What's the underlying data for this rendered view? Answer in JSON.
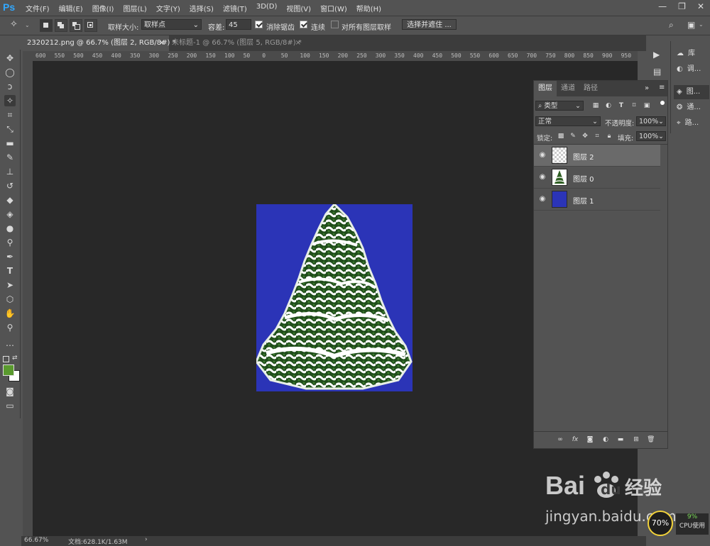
{
  "app": {
    "logo": "Ps"
  },
  "menu": [
    "文件(F)",
    "编辑(E)",
    "图像(I)",
    "图层(L)",
    "文字(Y)",
    "选择(S)",
    "滤镜(T)",
    "3D(D)",
    "视图(V)",
    "窗口(W)",
    "帮助(H)"
  ],
  "window_controls": {
    "minimize": "—",
    "restore": "❐",
    "close": "✕"
  },
  "options": {
    "sample_size_label": "取样大小:",
    "sample_size_value": "取样点",
    "tolerance_label": "容差:",
    "tolerance_value": "45",
    "antialias_label": "消除锯齿",
    "contiguous_label": "连续",
    "all_layers_label": "对所有图层取样",
    "select_mask_button": "选择并遮住 ..."
  },
  "tabs": [
    {
      "label": "2320212.png @ 66.7% (图层 2, RGB/8#) *",
      "close": "×"
    },
    {
      "label": "未标题-1 @ 66.7% (图层 5, RGB/8#) *",
      "close": "×"
    }
  ],
  "ruler_ticks": [
    "600",
    "550",
    "500",
    "450",
    "400",
    "350",
    "300",
    "250",
    "200",
    "150",
    "100",
    "50",
    "0",
    "50",
    "100",
    "150",
    "200",
    "250",
    "300",
    "350",
    "400",
    "450",
    "500",
    "550",
    "600",
    "650",
    "700",
    "750",
    "800",
    "850",
    "900",
    "950"
  ],
  "status": {
    "zoom": "66.67%",
    "doc": "文档:628.1K/1.63M",
    "arrow": "›"
  },
  "dock": [
    {
      "icon": "cc-libraries-icon",
      "label": "库"
    },
    {
      "icon": "adjustments-icon",
      "label": "调..."
    },
    {
      "icon": "layers-icon",
      "label": "图..."
    },
    {
      "icon": "channels-icon",
      "label": "通..."
    },
    {
      "icon": "paths-icon",
      "label": "路..."
    }
  ],
  "layers_panel": {
    "tabs": [
      "图层",
      "通道",
      "路径"
    ],
    "filter_kind": "类型",
    "blend_mode": "正常",
    "opacity_label": "不透明度:",
    "opacity_value": "100%",
    "lock_label": "锁定:",
    "fill_label": "填充:",
    "fill_value": "100%",
    "layers": [
      {
        "name": "图层 2",
        "thumb": "transparent",
        "selected": true
      },
      {
        "name": "图层 0",
        "thumb": "tree",
        "selected": false
      },
      {
        "name": "图层 1",
        "thumb": "blue",
        "selected": false
      }
    ]
  },
  "colors": {
    "foreground": "#5a9a2e",
    "background": "#ffffff",
    "artboard": "#2b34b7",
    "canvas": "#282828"
  },
  "watermark": {
    "brand": "Bai",
    "brand2": "du",
    "cn": "经验",
    "url": "jingyan.baidu.com"
  },
  "cpu": {
    "percent": "70%",
    "cpu_value": "9%",
    "cpu_label": "CPU使用"
  }
}
